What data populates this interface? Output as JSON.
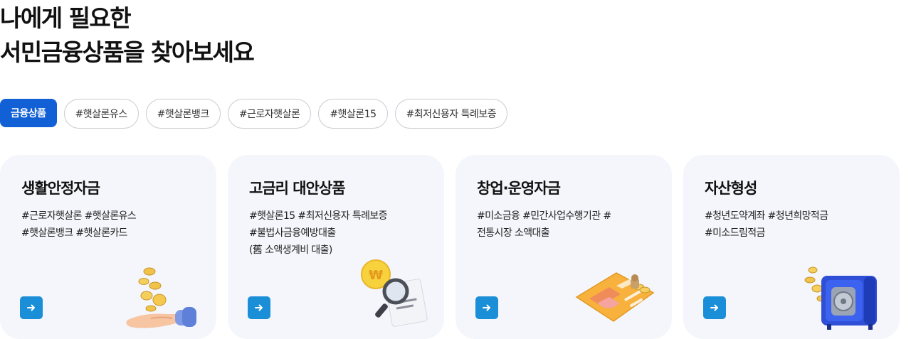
{
  "headline": {
    "line1": "나에게 필요한",
    "line2": "서민금융상품을 찾아보세요"
  },
  "tags": [
    {
      "label": "금융상품",
      "active": true
    },
    {
      "label": "#햇살론유스"
    },
    {
      "label": "#햇살론뱅크"
    },
    {
      "label": "#근로자햇살론"
    },
    {
      "label": "#햇살론15"
    },
    {
      "label": "#최저신용자 특례보증"
    }
  ],
  "cards": [
    {
      "title": "생활안정자금",
      "lines": [
        "#근로자햇살론 #햇살론유스",
        "#햇살론뱅크 #햇살론카드"
      ],
      "icon": "coins-hand-icon"
    },
    {
      "title": "고금리 대안상품",
      "lines": [
        "#햇살론15 #최저신용자 특례보증",
        "#불법사금융예방대출",
        "(舊 소액생계비 대출)"
      ],
      "icon": "won-magnifier-document-icon"
    },
    {
      "title": "창업·운영자금",
      "lines": [
        "#미소금융 #민간사업수행기관 #",
        "전통시장 소액대출"
      ],
      "icon": "business-card-chart-icon"
    },
    {
      "title": "자산형성",
      "lines": [
        "#청년도약계좌 #청년희망적금",
        "#미소드림적금"
      ],
      "icon": "safe-coins-icon"
    }
  ],
  "colors": {
    "accent": "#1260d6",
    "arrow_button": "#1a8fd8",
    "card_bg": "#f4f6fb"
  }
}
